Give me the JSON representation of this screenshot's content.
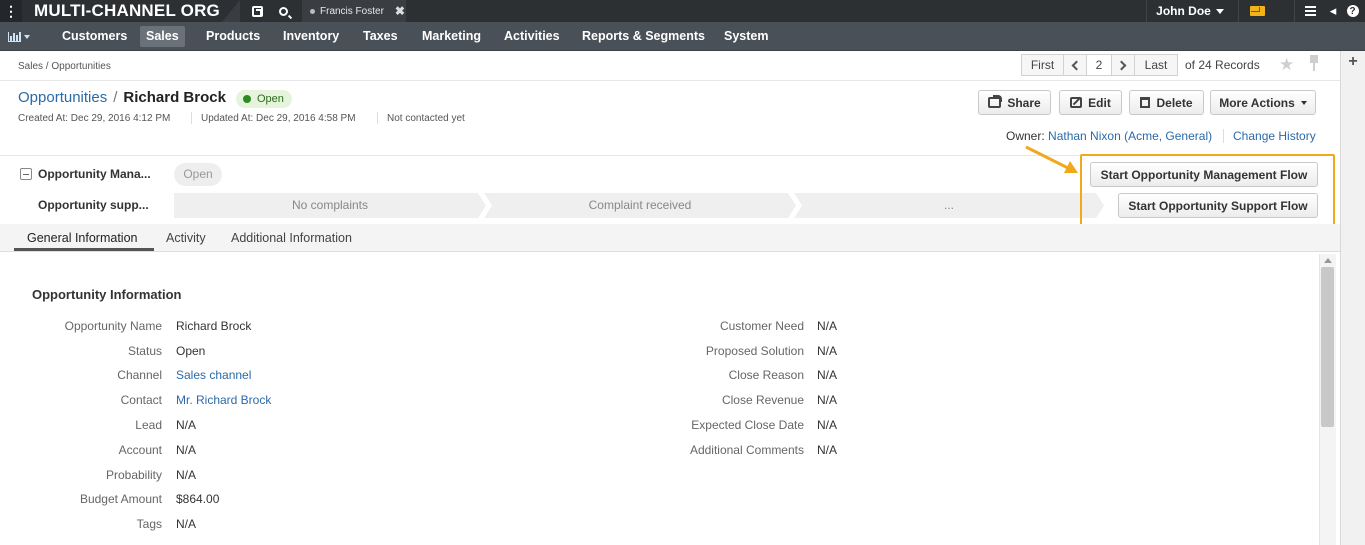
{
  "topbar": {
    "org_name": "MULTI-CHANNEL ORG",
    "recent_tab": "Francis Foster",
    "user_name": "John Doe",
    "help": "?"
  },
  "nav": {
    "items": [
      "Customers",
      "Sales",
      "Products",
      "Inventory",
      "Taxes",
      "Marketing",
      "Activities",
      "Reports & Segments",
      "System"
    ],
    "active": "Sales"
  },
  "breadcrumb": "Sales / Opportunities",
  "pager": {
    "first": "First",
    "current": "2",
    "last": "Last",
    "records": "of 24 Records"
  },
  "header": {
    "entity": "Opportunities",
    "separator": "/",
    "record_name": "Richard Brock",
    "status": "Open",
    "created": "Created At: Dec 29, 2016 4:12 PM",
    "updated": "Updated At: Dec 29, 2016 4:58 PM",
    "contacted": "Not contacted yet"
  },
  "actions": {
    "share": "Share",
    "edit": "Edit",
    "delete": "Delete",
    "more": "More Actions"
  },
  "owner": {
    "label": "Owner:",
    "value": "Nathan Nixon (Acme, General)",
    "history": "Change History"
  },
  "workflow": {
    "management_label": "Opportunity Mana...",
    "management_step": "Open",
    "support_label": "Opportunity supp...",
    "support_steps": [
      "No complaints",
      "Complaint received",
      "..."
    ],
    "start_management": "Start Opportunity Management Flow",
    "start_support": "Start Opportunity Support Flow",
    "callout_color": "#f0a81c"
  },
  "tabs": [
    "General Information",
    "Activity",
    "Additional Information"
  ],
  "section": {
    "title": "Opportunity Information",
    "left": [
      {
        "label": "Opportunity Name",
        "value": "Richard Brock"
      },
      {
        "label": "Status",
        "value": "Open"
      },
      {
        "label": "Channel",
        "value": "Sales channel"
      },
      {
        "label": "Contact",
        "value": "Mr. Richard Brock"
      },
      {
        "label": "Lead",
        "value": "N/A"
      },
      {
        "label": "Account",
        "value": "N/A"
      },
      {
        "label": "Probability",
        "value": "N/A"
      },
      {
        "label": "Budget Amount",
        "value": "$864.00"
      },
      {
        "label": "Tags",
        "value": "N/A"
      }
    ],
    "right": [
      {
        "label": "Customer Need",
        "value": "N/A"
      },
      {
        "label": "Proposed Solution",
        "value": "N/A"
      },
      {
        "label": "Close Reason",
        "value": "N/A"
      },
      {
        "label": "Close Revenue",
        "value": "N/A"
      },
      {
        "label": "Expected Close Date",
        "value": "N/A"
      },
      {
        "label": "Additional Comments",
        "value": "N/A"
      }
    ]
  },
  "icons": [
    "menu-icon",
    "bar-chart-icon",
    "external-link-icon",
    "search-icon",
    "envelope-icon",
    "hamburger-icon",
    "help-icon",
    "share-icon",
    "edit-icon",
    "trash-icon",
    "star-icon",
    "pin-icon",
    "plus-icon"
  ]
}
